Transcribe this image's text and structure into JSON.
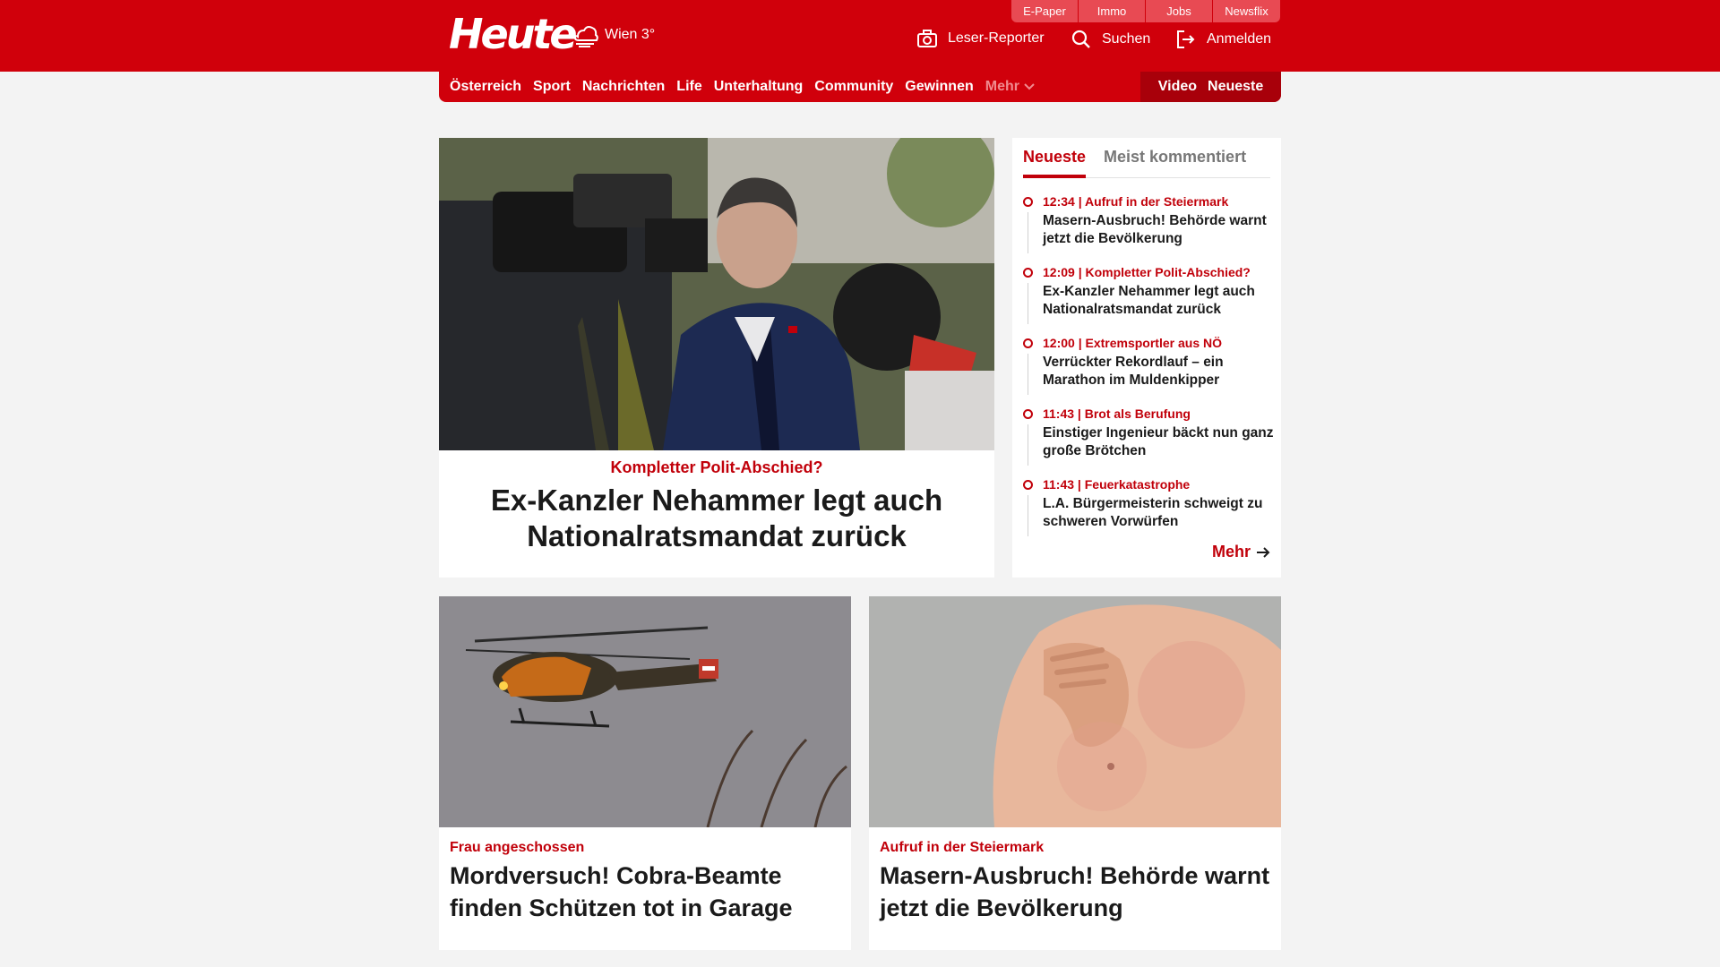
{
  "header": {
    "logo": "Heute",
    "weather": "Wien 3°",
    "top_links": [
      "E-Paper",
      "Immo",
      "Jobs",
      "Newsflix"
    ],
    "actions": {
      "reporter": "Leser-Reporter",
      "search": "Suchen",
      "login": "Anmelden"
    }
  },
  "nav": {
    "items": [
      "Österreich",
      "Sport",
      "Nachrichten",
      "Life",
      "Unterhaltung",
      "Community",
      "Gewinnen"
    ],
    "more": "Mehr",
    "video": "Video",
    "latest": "Neueste"
  },
  "lead": {
    "kicker": "Kompletter Polit-Abschied?",
    "title": "Ex-Kanzler Nehammer legt auch Nationalratsmandat zurück"
  },
  "sidebar": {
    "tabs": [
      "Neueste",
      "Meist kommentiert"
    ],
    "items": [
      {
        "meta": "12:34 | Aufruf in der Steiermark",
        "headline": "Masern-Ausbruch! Behörde warnt jetzt die Bevölkerung"
      },
      {
        "meta": "12:09 | Kompletter Polit-Abschied?",
        "headline": "Ex-Kanzler Nehammer legt auch Nationalratsmandat zurück"
      },
      {
        "meta": "12:00 | Extremsportler aus NÖ",
        "headline": "Verrückter Rekordlauf – ein Marathon im Muldenkipper"
      },
      {
        "meta": "11:43 | Brot als Berufung",
        "headline": "Einstiger Ingenieur bäckt nun ganz große Brötchen"
      },
      {
        "meta": "11:43 | Feuerkatastrophe",
        "headline": "L.A. Bürgermeisterin schweigt zu schweren Vorwürfen"
      }
    ],
    "more": "Mehr"
  },
  "cards": [
    {
      "kicker": "Frau angeschossen",
      "title": "Mordversuch! Cobra-Beamte finden Schützen tot in Garage"
    },
    {
      "kicker": "Aufruf in der Steiermark",
      "title": "Masern-Ausbruch! Behörde warnt jetzt die Bevölkerung"
    }
  ]
}
